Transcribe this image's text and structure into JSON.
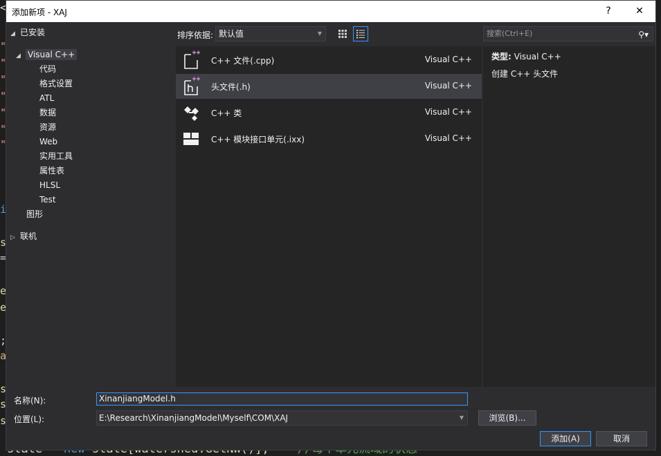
{
  "window": {
    "title": "添加新项 - XAJ",
    "help_label": "?",
    "close_label": "✕"
  },
  "tree": {
    "installed_label": "已安装",
    "visual_cpp_label": "Visual C++",
    "children": [
      "代码",
      "格式设置",
      "ATL",
      "数据",
      "资源",
      "Web",
      "实用工具",
      "属性表",
      "HLSL",
      "Test"
    ],
    "graphics_label": "图形",
    "online_label": "联机"
  },
  "toolbar": {
    "sort_label": "排序依据:",
    "sort_value": "默认值"
  },
  "templates": [
    {
      "name": "C++ 文件(.cpp)",
      "lang": "Visual C++",
      "icon": "cpp-file-icon",
      "selected": false
    },
    {
      "name": "头文件(.h)",
      "lang": "Visual C++",
      "icon": "header-file-icon",
      "selected": true
    },
    {
      "name": "C++ 类",
      "lang": "Visual C++",
      "icon": "class-icon",
      "selected": false
    },
    {
      "name": "C++ 模块接口单元(.ixx)",
      "lang": "Visual C++",
      "icon": "module-icon",
      "selected": false
    }
  ],
  "search": {
    "placeholder": "搜索(Ctrl+E)"
  },
  "details": {
    "type_label": "类型:",
    "type_value": "Visual C++",
    "description": "创建 C++ 头文件"
  },
  "form": {
    "name_label": "名称(N):",
    "name_value": "XinanjiangModel.h",
    "location_label": "位置(L):",
    "location_value": "E:\\Research\\XinanjiangModel\\Myself\\COM\\XAJ",
    "browse_label": "浏览(B)...",
    "add_label": "添加(A)",
    "cancel_label": "取消"
  },
  "background": {
    "margin_chars": [
      "<",
      "\"",
      "\"",
      "\"",
      "\"",
      "\"",
      "\"",
      "\"",
      "i",
      "s",
      "=",
      "e",
      "e",
      ";",
      "a",
      "s",
      "s",
      "s"
    ],
    "code_state": "state",
    "code_eq": " = ",
    "code_new": "new",
    "code_call": " state[watershed.GetNW()];",
    "code_comment": "    //每个单元流域的状态"
  },
  "colors": {
    "accent": "#3399ff",
    "dialog_bg": "#2d2d30",
    "panel_bg": "#252526",
    "selection": "#3f3f46"
  }
}
